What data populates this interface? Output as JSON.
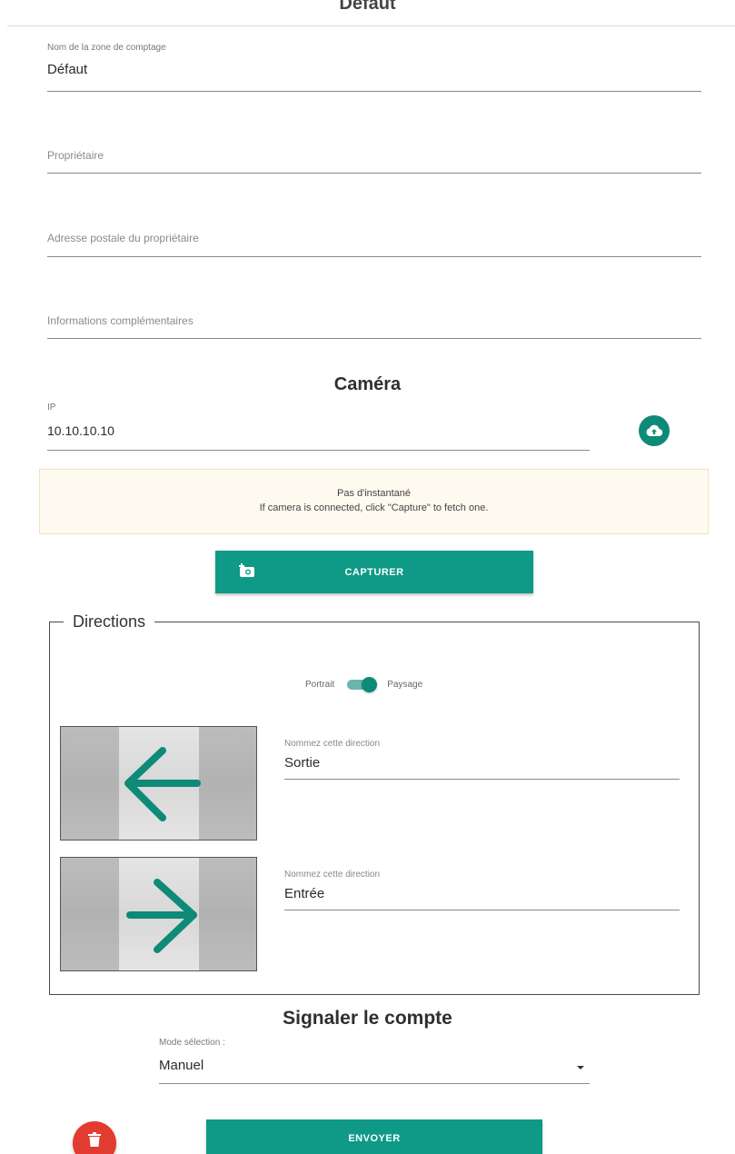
{
  "header": {
    "title": "Défaut"
  },
  "zone": {
    "name_label": "Nom de la zone de comptage",
    "name_value": "Défaut",
    "owner_placeholder": "Propriétaire",
    "address_placeholder": "Adresse postale du propriétaire",
    "info_placeholder": "Informations complémentaires"
  },
  "camera": {
    "title": "Caméra",
    "ip_label": "IP",
    "ip_value": "10.10.10.10",
    "upload_icon": "cloud-upload-icon",
    "notice_line1": "Pas d'instantané",
    "notice_line2": "If camera is connected, click \"Capture\" to fetch one.",
    "capture_label": "CAPTURER",
    "capture_icon": "camera-capture-icon"
  },
  "directions": {
    "legend": "Directions",
    "orientation_left": "Portrait",
    "orientation_right": "Paysage",
    "orientation_is_landscape": true,
    "items": [
      {
        "label": "Nommez cette direction",
        "value": "Sortie",
        "arrow": "arrow-left-icon"
      },
      {
        "label": "Nommez cette direction",
        "value": "Entrée",
        "arrow": "arrow-right-icon"
      }
    ]
  },
  "report": {
    "title": "Signaler le compte",
    "mode_label": "Mode sélection :",
    "mode_value": "Manuel",
    "send_label": "ENVOYER",
    "delete_icon": "trash-icon"
  },
  "colors": {
    "accent": "#0e9a86",
    "danger": "#e23b2f",
    "notice_bg": "#fffaf0"
  }
}
